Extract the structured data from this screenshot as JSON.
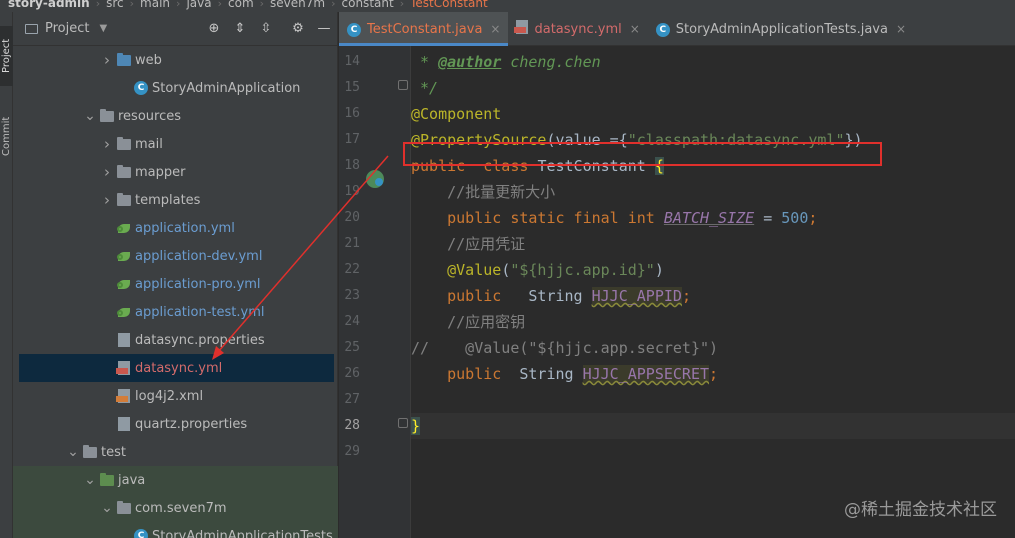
{
  "breadcrumb": [
    "story-admin",
    "src",
    "main",
    "java",
    "com",
    "seven7m",
    "constant",
    "TestConstant"
  ],
  "toolstrip": {
    "project_tab": "Project",
    "commit_tab": "Commit"
  },
  "project_panel": {
    "title": "Project"
  },
  "tree": [
    {
      "label": "web",
      "kind": "folder",
      "indent": 3,
      "chevron": "right",
      "style": "src"
    },
    {
      "label": "StoryAdminApplication",
      "kind": "class",
      "indent": 4
    },
    {
      "label": "resources",
      "kind": "folder",
      "indent": 2,
      "chevron": "down",
      "style": "res"
    },
    {
      "label": "mail",
      "kind": "folder",
      "indent": 3,
      "chevron": "right",
      "style": "res"
    },
    {
      "label": "mapper",
      "kind": "folder",
      "indent": 3,
      "chevron": "right",
      "style": "res"
    },
    {
      "label": "templates",
      "kind": "folder",
      "indent": 3,
      "chevron": "right",
      "style": "res"
    },
    {
      "label": "application.yml",
      "kind": "yml",
      "indent": 3
    },
    {
      "label": "application-dev.yml",
      "kind": "yml",
      "indent": 3
    },
    {
      "label": "application-pro.yml",
      "kind": "yml",
      "indent": 3
    },
    {
      "label": "application-test.yml",
      "kind": "yml",
      "indent": 3
    },
    {
      "label": "datasync.properties",
      "kind": "props",
      "indent": 3
    },
    {
      "label": "datasync.yml",
      "kind": "ymlfile",
      "indent": 3,
      "selected": true
    },
    {
      "label": "log4j2.xml",
      "kind": "xml",
      "indent": 3
    },
    {
      "label": "quartz.properties",
      "kind": "props",
      "indent": 3
    },
    {
      "label": "test",
      "kind": "folder",
      "indent": 1,
      "chevron": "down",
      "style": "res"
    },
    {
      "label": "java",
      "kind": "folder",
      "indent": 2,
      "chevron": "down",
      "style": "test-src",
      "test": true
    },
    {
      "label": "com.seven7m",
      "kind": "folder",
      "indent": 3,
      "chevron": "down",
      "style": "res",
      "test": true
    },
    {
      "label": "StoryAdminApplicationTests",
      "kind": "class",
      "indent": 4,
      "test": true
    }
  ],
  "tabs": [
    {
      "name": "TestConstant.java",
      "kind": "java",
      "active": true
    },
    {
      "name": "datasync.yml",
      "kind": "yml",
      "active": false
    },
    {
      "name": "StoryAdminApplicationTests.java",
      "kind": "plain",
      "active": false
    }
  ],
  "editor": {
    "line_numbers": [
      "14",
      "15",
      "16",
      "17",
      "18",
      "19",
      "20",
      "21",
      "22",
      "23",
      "24",
      "25",
      "26",
      "27",
      "28",
      "29"
    ],
    "current_line": "28",
    "lines": [
      [
        [
          "t-doc",
          " * "
        ],
        [
          "t-tag",
          "@author"
        ],
        [
          "t-doc",
          " cheng.chen"
        ]
      ],
      [
        [
          "t-doc",
          " */"
        ]
      ],
      [
        [
          "t-anno",
          "@Component"
        ]
      ],
      [
        [
          "t-anno",
          "@PropertySource"
        ],
        [
          "t-plain",
          "(value ={"
        ],
        [
          "t-str",
          "\"classpath:datasync.yml\""
        ],
        [
          "t-plain",
          "})"
        ]
      ],
      [
        [
          "t-kw",
          "public  class "
        ],
        [
          "t-plain",
          "TestConstant "
        ],
        [
          "t-brace-hl",
          "{"
        ]
      ],
      [
        [
          "t-cmt",
          "    //批量更新大小"
        ]
      ],
      [
        [
          "t-kw",
          "    public static final int "
        ],
        [
          "t-const",
          "BATCH_SIZE"
        ],
        [
          "t-plain",
          " = "
        ],
        [
          "t-num",
          "500"
        ],
        [
          "t-kw",
          ";"
        ]
      ],
      [
        [
          "t-cmt",
          "    //应用凭证"
        ]
      ],
      [
        [
          "t-plain",
          "    "
        ],
        [
          "t-anno",
          "@Value"
        ],
        [
          "t-plain",
          "("
        ],
        [
          "t-str",
          "\"${hjjc.app.id}\""
        ],
        [
          "t-plain",
          ")"
        ]
      ],
      [
        [
          "t-kw",
          "    public   "
        ],
        [
          "t-plain",
          "String "
        ],
        [
          "t-field-warn",
          "HJJC_APPID"
        ],
        [
          "t-kw",
          ";"
        ]
      ],
      [
        [
          "t-cmt",
          "    //应用密钥"
        ]
      ],
      [
        [
          "t-cmt",
          "//    @Value(\"${hjjc.app.secret}\")"
        ]
      ],
      [
        [
          "t-kw",
          "    public  "
        ],
        [
          "t-plain",
          "String "
        ],
        [
          "t-field-warn",
          "HJJC_APPSECRET"
        ],
        [
          "t-kw",
          ";"
        ]
      ],
      [
        [
          "t-plain",
          ""
        ]
      ],
      [
        [
          "t-brace-hl",
          "}"
        ]
      ],
      [
        [
          "t-plain",
          ""
        ]
      ]
    ]
  },
  "watermark": "@稀土掘金技术社区",
  "colors": {
    "accent": "#4a88c7",
    "annotation_box": "#e0302c",
    "arrow": "#e0302c"
  }
}
